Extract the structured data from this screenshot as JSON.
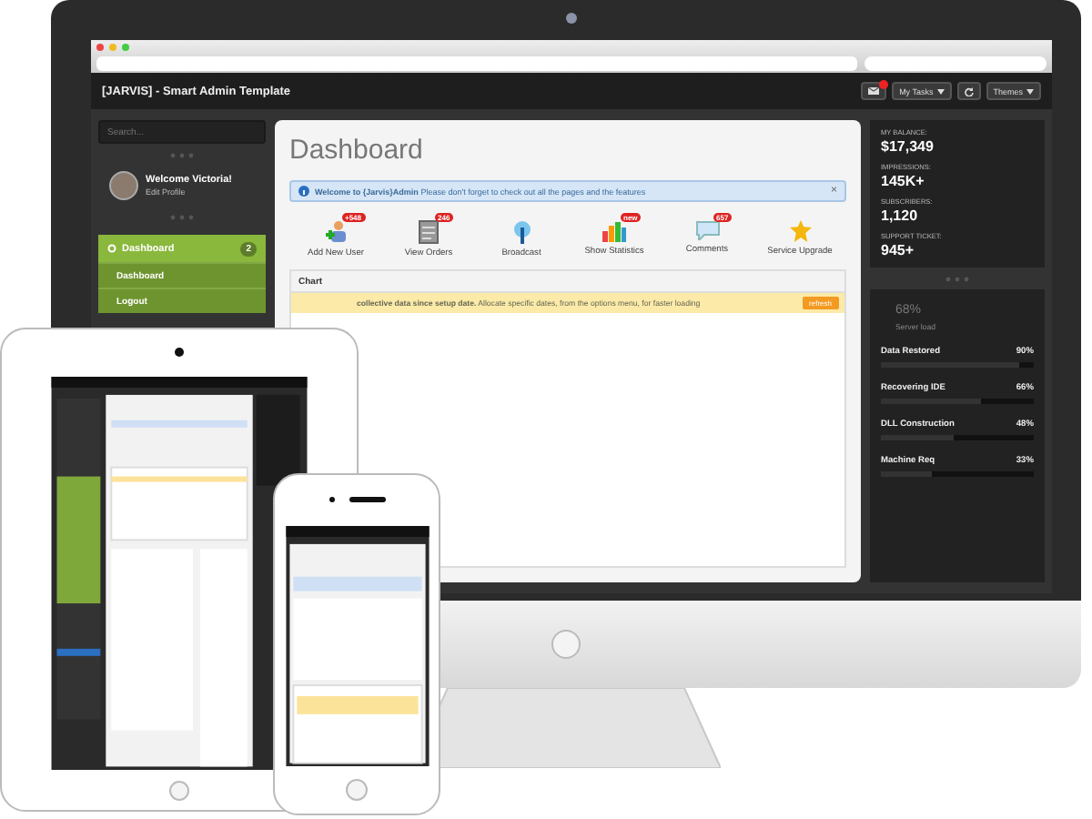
{
  "app": {
    "title": "[JARVIS] - Smart Admin Template",
    "mail_unread": true,
    "buttons": [
      {
        "label": "My Tasks",
        "dropdown": true
      },
      {
        "label": "Themes",
        "dropdown": true
      }
    ]
  },
  "sidebar": {
    "search_placeholder": "Search...",
    "user": {
      "greeting": "Welcome Victoria!",
      "link": "Edit Profile"
    },
    "nav": [
      {
        "label": "Dashboard",
        "count": "2",
        "expanded": true,
        "children": [
          {
            "label": "Dashboard"
          },
          {
            "label": "Logout"
          }
        ]
      }
    ]
  },
  "main": {
    "title": "Dashboard",
    "alert": {
      "text": "**Welcome to {Jarvis}Admin** Please don't forget to check out all the pages and the features",
      "close": "×"
    },
    "shortcuts": [
      {
        "label": "Add New User",
        "kind": "user-add",
        "badge": "+548"
      },
      {
        "label": "View Orders",
        "kind": "orders",
        "badge": "246"
      },
      {
        "label": "Broadcast",
        "kind": "broadcast"
      },
      {
        "label": "Show Statistics",
        "kind": "statistics",
        "badge": "new"
      },
      {
        "label": "Comments",
        "kind": "comments",
        "badge": "657"
      },
      {
        "label": "Service Upgrade",
        "kind": "upgrade"
      }
    ],
    "chart_panel": {
      "title": "Chart",
      "warning": "**collective data since setup date.** Allocate specific dates, from the options menu, for faster loading",
      "button": "refresh"
    }
  },
  "right_panel": {
    "stats": [
      {
        "label": "MY BALANCE:",
        "value": "$17,349"
      },
      {
        "label": "IMPRESSIONS:",
        "value": "145K+"
      },
      {
        "label": "SUBSCRIBERS:",
        "value": "1,120"
      },
      {
        "label": "SUPPORT TICKET:",
        "value": "945+"
      }
    ],
    "server_load": {
      "value": "68%",
      "label": "Server load"
    },
    "progress": [
      {
        "label": "Data Restored",
        "reading": "90%",
        "level": 0.9
      },
      {
        "label": "Recovering IDE",
        "reading": "66%",
        "level": 0.66
      },
      {
        "label": "DLL Construction",
        "reading": "48%",
        "level": 0.48
      },
      {
        "label": "Machine Req",
        "reading": "33%",
        "level": 0.33
      }
    ]
  }
}
